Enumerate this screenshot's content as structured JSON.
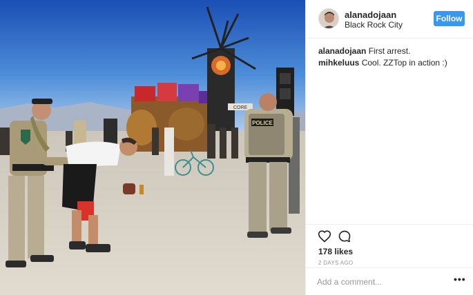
{
  "post": {
    "username": "alanadojaan",
    "location": "Black Rock City",
    "follow_label": "Follow",
    "comments": [
      {
        "user": "alanadojaan",
        "text": "First arrest."
      },
      {
        "user": "mihkeluus",
        "text": "Cool. ZZTop in action :)"
      }
    ],
    "likes_label": "178 likes",
    "time_ago": "2 DAYS AGO",
    "comment_placeholder": "Add a comment...",
    "more_label": "•••"
  },
  "photo": {
    "badge_text": "POLICE",
    "vehicle_sign": "CORE"
  },
  "icons": {
    "like": "heart-icon",
    "comment": "speech-bubble-icon",
    "more": "ellipsis-icon"
  },
  "colors": {
    "accent": "#3897f0",
    "sky_top": "#1f5fc2",
    "sky_bottom": "#8ab7e6",
    "playa": "#d8d0c4"
  }
}
